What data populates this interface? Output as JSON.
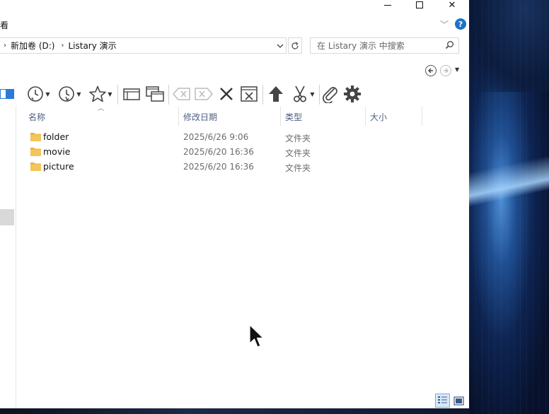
{
  "window": {
    "ribbon_tab_label": "看",
    "controls": {
      "minimize": "",
      "maximize": "",
      "close": "✕"
    },
    "help": "?"
  },
  "address_bar": {
    "breadcrumbs": [
      "新加卷 (D:)",
      "Listary 演示"
    ],
    "separator": "›",
    "search_placeholder": "在 Listary 演示 中搜索"
  },
  "columns": [
    "名称",
    "修改日期",
    "类型",
    "大小"
  ],
  "files": [
    {
      "name": "folder",
      "modified": "2025/6/26 9:06",
      "type": "文件夹",
      "size": ""
    },
    {
      "name": "movie",
      "modified": "2025/6/20 16:36",
      "type": "文件夹",
      "size": ""
    },
    {
      "name": "picture",
      "modified": "2025/6/20 16:36",
      "type": "文件夹",
      "size": ""
    }
  ],
  "toolbar_icons": [
    "recent-clock-icon",
    "history-clock-icon",
    "favorites-star-icon",
    "new-window-icon",
    "duplicate-window-icon",
    "backspace-icon",
    "delete-x-icon",
    "close-icon",
    "close-window-icon",
    "up-arrow-icon",
    "scissors-icon",
    "paperclip-icon",
    "gear-icon"
  ],
  "colors": {
    "accent_blue": "#1a73c7",
    "folder_yellow": "#f4c55a",
    "header_text": "#4d6082"
  }
}
